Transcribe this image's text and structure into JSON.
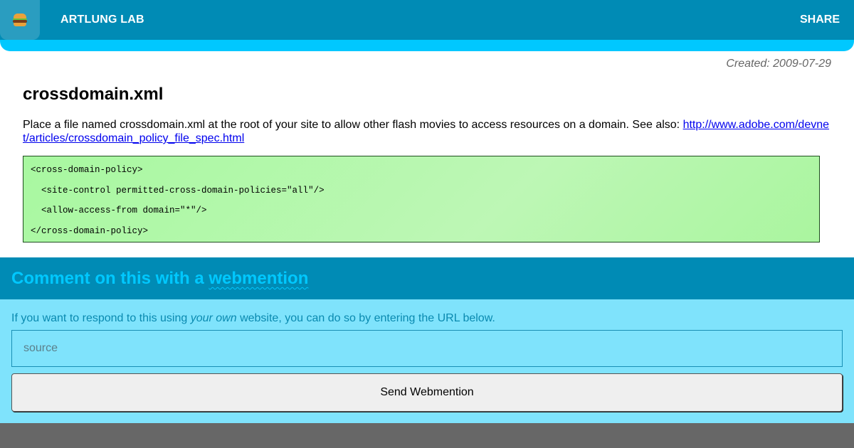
{
  "header": {
    "site_title": "ARTLUNG LAB",
    "share_label": "SHARE",
    "logo_icon": "hamburger-icon"
  },
  "article": {
    "created": "Created: 2009-07-29",
    "title": "crossdomain.xml",
    "intro_text": "Place a file named crossdomain.xml at the root of your site to allow other flash movies to access resources on a domain. See also: ",
    "link_text": "http://www.adobe.com/devnet/articles/crossdomain_policy_file_spec.html",
    "code_lines": [
      "<cross-domain-policy>",
      "  <site-control permitted-cross-domain-policies=\"all\"/>",
      "  <allow-access-from domain=\"*\"/>",
      "</cross-domain-policy>"
    ]
  },
  "webmention": {
    "heading_prefix": "Comment on this with a ",
    "heading_link": "webmention",
    "text_before": "If you want to respond to this using ",
    "text_em": "your own",
    "text_after": " website, you can do so by entering the URL below.",
    "input_placeholder": "source",
    "button_label": "Send Webmention"
  },
  "colors": {
    "header_bg": "#008bb5",
    "accent": "#00c8ff",
    "code_bg": "#a8f8a0",
    "webmention_bg": "#7fe3fc",
    "footer_bg": "#676767"
  }
}
